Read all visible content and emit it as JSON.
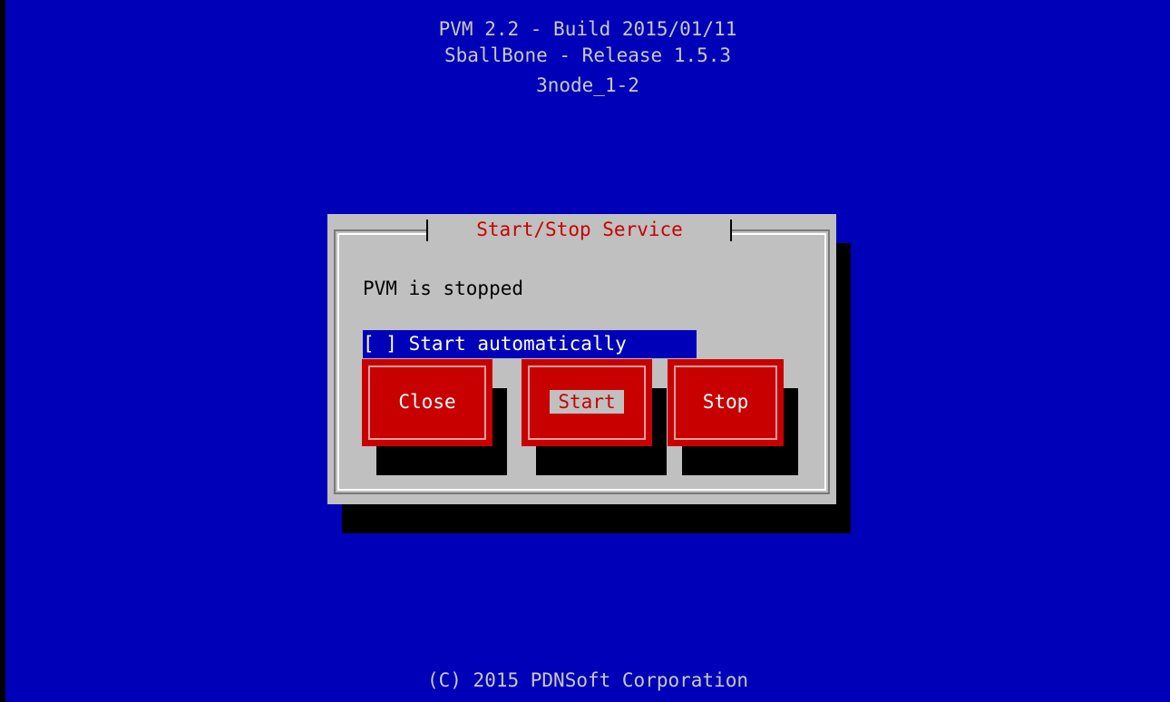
{
  "header": {
    "line1": "PVM 2.2 - Build 2015/01/11",
    "line2": "SballBone - Release 1.5.3",
    "line3": "3node_1-2"
  },
  "dialog": {
    "title": "Start/Stop Service",
    "status": "PVM is stopped",
    "checkbox_label": "[ ] Start automatically",
    "checkbox_checked": false
  },
  "buttons": {
    "close_label": "Close",
    "start_label": "Start",
    "stop_label": "Stop",
    "focused": "Start"
  },
  "footer": {
    "copyright": "(C) 2015 PDNSoft Corporation"
  },
  "colors": {
    "background": "#0000b8",
    "dialog": "#c0c0c0",
    "button": "#c80000",
    "title_text": "#c80000",
    "header_text": "#c8c8c8"
  }
}
